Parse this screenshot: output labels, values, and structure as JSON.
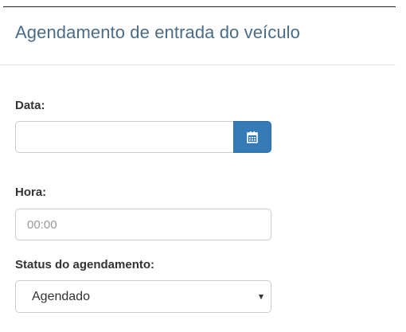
{
  "header": {
    "title": "Agendamento de entrada do veículo"
  },
  "form": {
    "date": {
      "label": "Data:",
      "value": "",
      "button_icon": "calendar-icon"
    },
    "time": {
      "label": "Hora:",
      "value": "",
      "placeholder": "00:00"
    },
    "status": {
      "label": "Status do agendamento:",
      "selected": "Agendado",
      "icon": "caret-down-icon"
    }
  },
  "colors": {
    "title": "#4a6c87",
    "accent_button": "#337ab7",
    "input_border": "#cccccc",
    "label": "#333333"
  }
}
